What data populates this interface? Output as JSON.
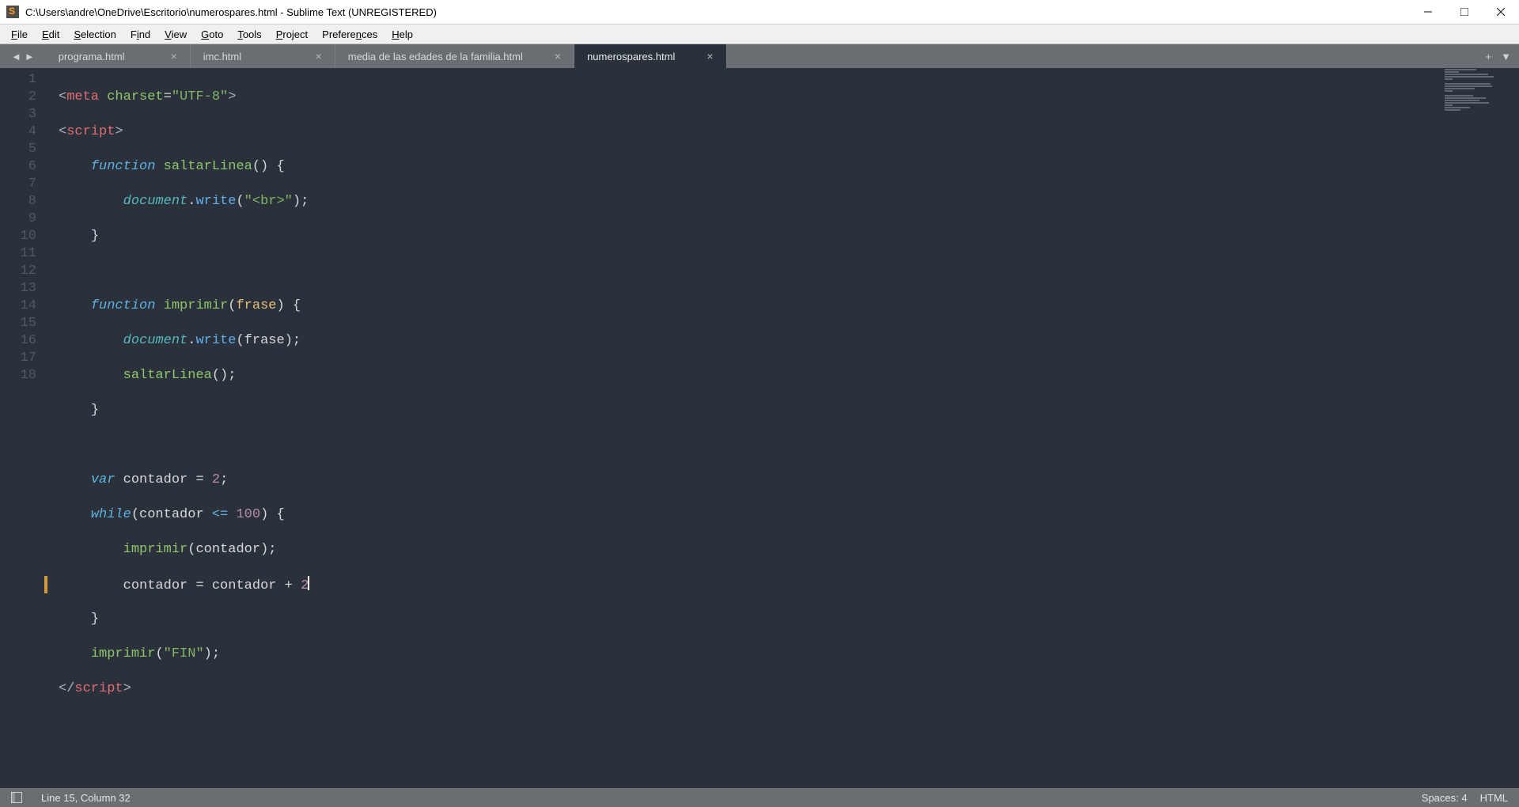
{
  "window": {
    "title": "C:\\Users\\andre\\OneDrive\\Escritorio\\numerospares.html - Sublime Text (UNREGISTERED)"
  },
  "menu": {
    "items": [
      {
        "label": "File",
        "ul": "F"
      },
      {
        "label": "Edit",
        "ul": "E"
      },
      {
        "label": "Selection",
        "ul": "S"
      },
      {
        "label": "Find",
        "ul": "i"
      },
      {
        "label": "View",
        "ul": "V"
      },
      {
        "label": "Goto",
        "ul": "G"
      },
      {
        "label": "Tools",
        "ul": "T"
      },
      {
        "label": "Project",
        "ul": "P"
      },
      {
        "label": "Preferences",
        "ul": "n"
      },
      {
        "label": "Help",
        "ul": "H"
      }
    ]
  },
  "tabs": {
    "items": [
      {
        "label": "programa.html",
        "active": false,
        "close": "×"
      },
      {
        "label": "imc.html",
        "active": false,
        "close": "×"
      },
      {
        "label": "media de las edades de la familia.html",
        "active": false,
        "close": "×"
      },
      {
        "label": "numerospares.html",
        "active": true,
        "close": "×"
      }
    ],
    "nav_back": "◄",
    "nav_fwd": "►",
    "add": "+",
    "menu": "▼"
  },
  "editor": {
    "line_count": 18,
    "modified_line": 15,
    "cursor": {
      "line": 15,
      "col": 32
    }
  },
  "code": {
    "l1": {
      "ang_o": "<",
      "tag": "meta",
      "sp": " ",
      "attr": "charset",
      "eq": "=",
      "str": "\"UTF-8\"",
      "ang_c": ">"
    },
    "l2": {
      "ang_o": "<",
      "tag": "script",
      "ang_c": ">"
    },
    "l3": {
      "kw": "function",
      "sp": " ",
      "fn": "saltarLinea",
      "paren": "() {"
    },
    "l4": {
      "obj": "document",
      "dot": ".",
      "call": "write",
      "paren_o": "(",
      "str": "\"<br>\"",
      "paren_c": ");"
    },
    "l5": {
      "brace": "}"
    },
    "l7": {
      "kw": "function",
      "sp": " ",
      "fn": "imprimir",
      "paren_o": "(",
      "par": "frase",
      "paren_c": ") {"
    },
    "l8": {
      "obj": "document",
      "dot": ".",
      "call": "write",
      "paren_o": "(",
      "arg": "frase",
      "paren_c": ");"
    },
    "l9": {
      "fn": "saltarLinea",
      "paren": "();"
    },
    "l10": {
      "brace": "}"
    },
    "l12": {
      "kw": "var",
      "sp": " ",
      "id": "contador",
      "op": " = ",
      "num": "2",
      "semi": ";"
    },
    "l13": {
      "kw": "while",
      "paren_o": "(",
      "id": "contador",
      "sp": " ",
      "cmp": "<=",
      "sp2": " ",
      "num": "100",
      "paren_c": ") {"
    },
    "l14": {
      "fn": "imprimir",
      "paren_o": "(",
      "arg": "contador",
      "paren_c": ");"
    },
    "l15": {
      "id": "contador",
      "op": " = ",
      "id2": "contador",
      "plus": " + ",
      "num": "2"
    },
    "l16": {
      "brace": "}"
    },
    "l17": {
      "fn": "imprimir",
      "paren_o": "(",
      "str": "\"FIN\"",
      "paren_c": ");"
    },
    "l18": {
      "ang_o": "</",
      "tag": "script",
      "ang_c": ">"
    }
  },
  "status": {
    "line_col": "Line 15, Column 32",
    "spaces": "Spaces: 4",
    "syntax": "HTML"
  },
  "colors": {
    "bg": "#2b313a",
    "tabbar": "#6a6d72",
    "tag": "#e06c75",
    "keyword": "#5fb3e3",
    "function": "#8fc56c",
    "string": "#81b368",
    "object": "#56b6c2"
  }
}
